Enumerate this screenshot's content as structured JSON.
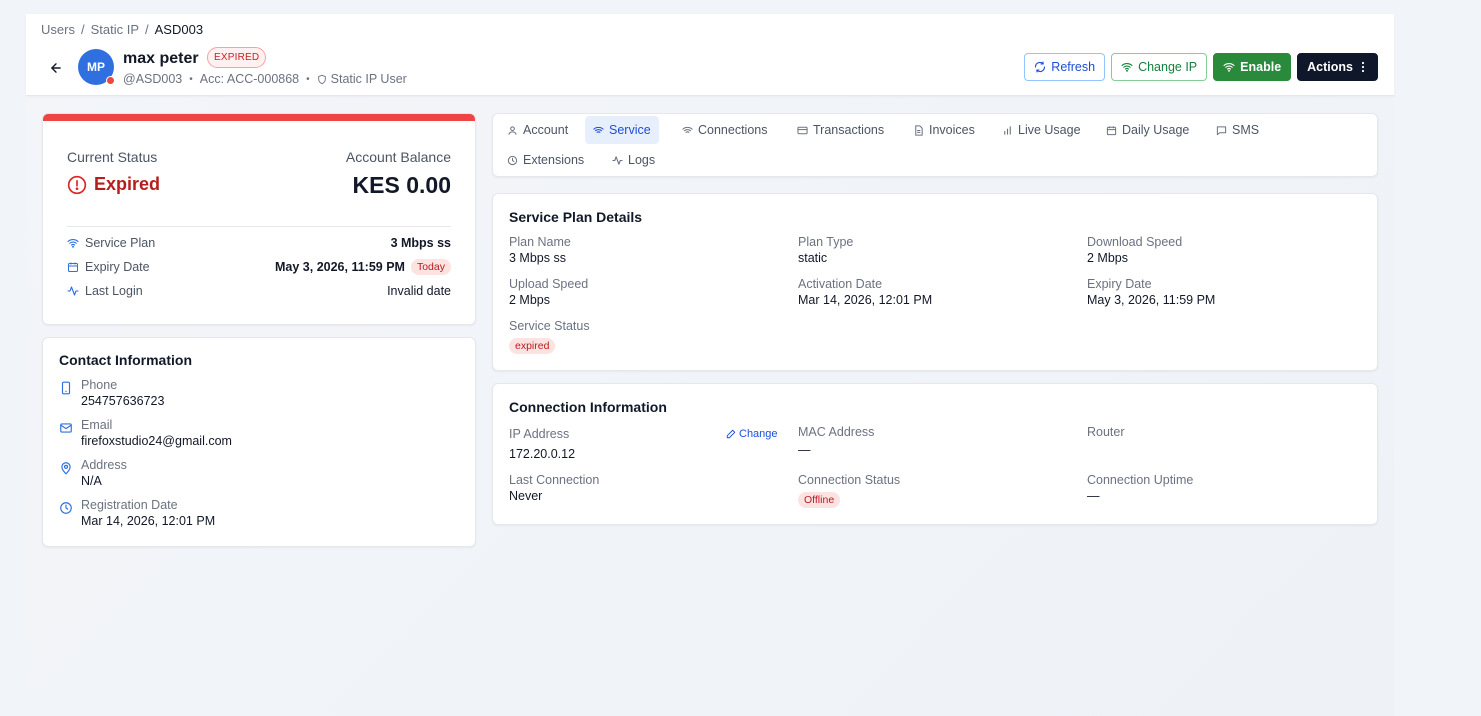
{
  "breadcrumb": {
    "items": [
      "Users",
      "Static IP"
    ],
    "separator": "/",
    "current": "ASD003"
  },
  "user": {
    "initials": "MP",
    "name": "max peter",
    "status_badge": "EXPIRED",
    "username": "@ASD003",
    "account": "Acc: ACC-000868",
    "type": "Static IP User",
    "dot": "•"
  },
  "header_actions": {
    "refresh": "Refresh",
    "change_ip": "Change IP",
    "enable": "Enable",
    "actions": "Actions"
  },
  "status_card": {
    "current_status_label": "Current Status",
    "current_status_value": "Expired",
    "balance_label": "Account Balance",
    "balance_value": "KES 0.00",
    "rows": [
      {
        "label": "Service Plan",
        "value": "3 Mbps ss"
      },
      {
        "label": "Expiry Date",
        "value": "May 3, 2026, 11:59 PM",
        "badge": "Today"
      },
      {
        "label": "Last Login",
        "value": "Invalid date"
      }
    ]
  },
  "contact": {
    "title": "Contact Information",
    "items": [
      {
        "label": "Phone",
        "value": "254757636723"
      },
      {
        "label": "Email",
        "value": "firefoxstudio24@gmail.com"
      },
      {
        "label": "Address",
        "value": "N/A"
      },
      {
        "label": "Registration Date",
        "value": "Mar 14, 2026, 12:01 PM"
      }
    ]
  },
  "tabs": [
    {
      "label": "Account"
    },
    {
      "label": "Service",
      "active": true
    },
    {
      "label": "Connections"
    },
    {
      "label": "Transactions"
    },
    {
      "label": "Invoices"
    },
    {
      "label": "Live Usage"
    },
    {
      "label": "Daily Usage"
    },
    {
      "label": "SMS"
    },
    {
      "label": "Extensions"
    },
    {
      "label": "Logs"
    }
  ],
  "plan": {
    "title": "Service Plan Details",
    "fields": [
      {
        "label": "Plan Name",
        "value": "3 Mbps ss"
      },
      {
        "label": "Plan Type",
        "value": "static"
      },
      {
        "label": "Download Speed",
        "value": "2 Mbps"
      },
      {
        "label": "Upload Speed",
        "value": "2 Mbps"
      },
      {
        "label": "Activation Date",
        "value": "Mar 14, 2026, 12:01 PM"
      },
      {
        "label": "Expiry Date",
        "value": "May 3, 2026, 11:59 PM"
      },
      {
        "label": "Service Status",
        "value": "expired"
      }
    ]
  },
  "connection": {
    "title": "Connection Information",
    "change_label": "Change",
    "fields": [
      {
        "label": "IP Address",
        "value": "172.20.0.12"
      },
      {
        "label": "MAC Address",
        "value": "—"
      },
      {
        "label": "Router",
        "value": ""
      },
      {
        "label": "Last Connection",
        "value": "Never"
      },
      {
        "label": "Connection Status",
        "value": "Offline"
      },
      {
        "label": "Connection Uptime",
        "value": "—"
      }
    ]
  },
  "colors": {
    "primary": "#2f6fe0",
    "danger": "#ef4444",
    "success": "#2a8a3c",
    "dark": "#0f172a"
  }
}
